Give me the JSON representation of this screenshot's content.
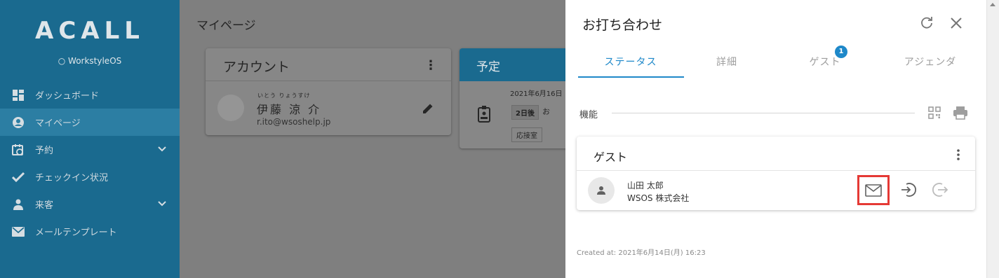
{
  "sidebar": {
    "logo": "ACALL",
    "logo_sub": "WorkstyleOS",
    "items": [
      {
        "label": "ダッシュボード",
        "icon": "dashboard-icon"
      },
      {
        "label": "マイページ",
        "icon": "account-circle-icon",
        "active": true
      },
      {
        "label": "予約",
        "icon": "calendar-clock-icon",
        "has_chevron": true
      },
      {
        "label": "チェックイン状況",
        "icon": "check-icon"
      },
      {
        "label": "来客",
        "icon": "visitor-icon",
        "has_chevron": true
      },
      {
        "label": "メールテンプレート",
        "icon": "mail-icon"
      }
    ]
  },
  "main": {
    "title": "マイページ",
    "account": {
      "title": "アカウント",
      "furigana": "いとう りょうすけ",
      "name": "伊藤 涼 介",
      "email": "r.ito@wsoshelp.jp"
    },
    "schedule": {
      "title": "予定",
      "date": "2021年6月16日",
      "badge": "2日後",
      "type": "お",
      "room": "応接室"
    }
  },
  "panel": {
    "title": "お打ち合わせ",
    "tabs": [
      {
        "label": "ステータス",
        "active": true
      },
      {
        "label": "詳細"
      },
      {
        "label": "ゲスト",
        "badge": "1"
      },
      {
        "label": "アジェンダ"
      }
    ],
    "section_label": "機能",
    "guest_card": {
      "title": "ゲスト",
      "guest_name": "山田 太郎",
      "guest_company": "WSOS 株式会社"
    },
    "created_at": "Created at: 2021年6月14日(月) 16:23"
  },
  "colors": {
    "sidebar": "#1a6a8f",
    "accent": "#1e88c9",
    "highlight": "#e53935"
  }
}
